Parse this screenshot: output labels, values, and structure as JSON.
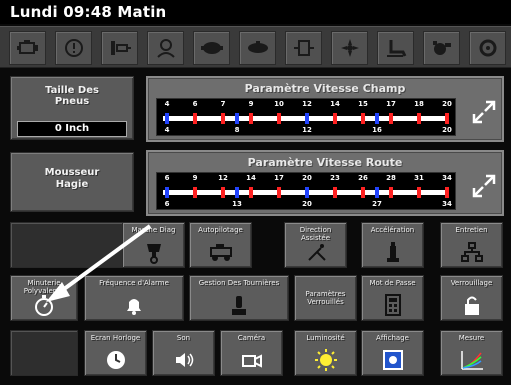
{
  "header": {
    "datetime": "Lundi 09:48 Matin"
  },
  "iconbar": {
    "icons": [
      "engine-icon",
      "tire-warning-icon",
      "hydraulic-icon",
      "operator-icon",
      "pump-icon",
      "spray-boom-icon",
      "spray-nozzle-icon",
      "fan-icon",
      "seat-icon",
      "water-pump-icon",
      "settings-icon"
    ]
  },
  "tire_size": {
    "label": "Taille Des Pneus",
    "value": "0 Inch"
  },
  "foamer": {
    "label": "Mousseur Hagie"
  },
  "field_speed": {
    "title": "Paramètre Vitesse Champ",
    "top_ticks": [
      "4",
      "6",
      "7",
      "9",
      "10",
      "12",
      "14",
      "15",
      "17",
      "18",
      "20"
    ],
    "bottom_ticks": [
      "4",
      "8",
      "12",
      "16",
      "20"
    ]
  },
  "road_speed": {
    "title": "Paramètre Vitesse Route",
    "top_ticks": [
      "6",
      "9",
      "12",
      "14",
      "17",
      "20",
      "23",
      "26",
      "28",
      "31",
      "34"
    ],
    "bottom_ticks": [
      "6",
      "13",
      "20",
      "27",
      "34"
    ]
  },
  "grid": {
    "row1": [
      {
        "label": "",
        "icon": ""
      },
      {
        "label": "Marche Diag",
        "icon": "diag-icon"
      },
      {
        "label": "Autopilotage",
        "icon": "tractor-icon"
      },
      {
        "label": "Direction Assistée",
        "icon": "antenna-icon"
      },
      {
        "label": "Accélération",
        "icon": "throttle-icon"
      },
      {
        "label": "Entretien",
        "icon": "network-icon"
      }
    ],
    "row2": [
      {
        "label": "Minuterie Polyvalente",
        "icon": "stopwatch-icon"
      },
      {
        "label": "Fréquence d'Alarme",
        "icon": "bell-icon"
      },
      {
        "label": "Gestion Des Tournières",
        "icon": "joystick-icon"
      },
      {
        "label": "Paramètres Verrouillés",
        "icon": ""
      },
      {
        "label": "Mot de Passe",
        "icon": "calculator-icon"
      },
      {
        "label": "Verrouillage",
        "icon": "lock-icon"
      }
    ],
    "row3": [
      {
        "label": "",
        "icon": ""
      },
      {
        "label": "Ecran Horloge",
        "icon": "clock-icon"
      },
      {
        "label": "Son",
        "icon": "speaker-icon"
      },
      {
        "label": "Caméra",
        "icon": "camera-icon"
      },
      {
        "label": "Luminosité",
        "icon": "sun-icon"
      },
      {
        "label": "Affichage",
        "icon": "display-icon"
      },
      {
        "label": "Mesure",
        "icon": "graph-icon"
      }
    ]
  }
}
